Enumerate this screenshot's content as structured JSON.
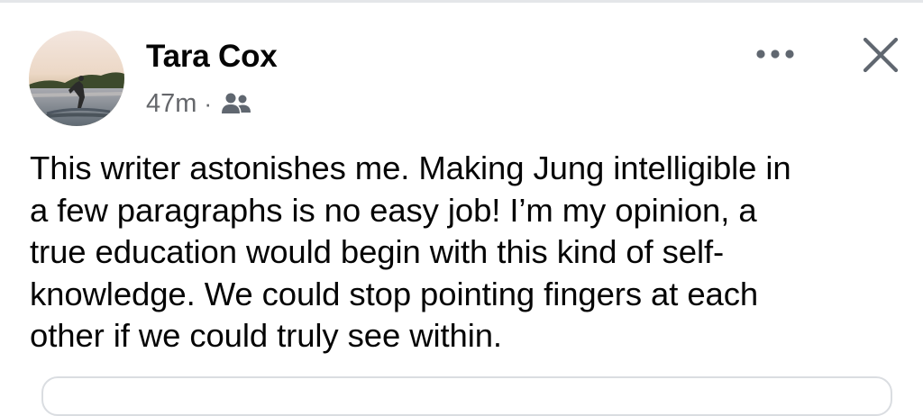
{
  "post": {
    "author": "Tara Cox",
    "time": "47m",
    "separator": "·",
    "audience_icon": "friends-icon",
    "more_icon": "more-horizontal-icon",
    "close_icon": "close-icon",
    "text_lines": [
      "This writer astonishes me. Making Jung intelligible in",
      "a few paragraphs is no easy job! I’m my opinion, a",
      "true education would begin with this kind of self-",
      "knowledge. We could stop pointing fingers at each",
      "other if we could truly see within."
    ]
  },
  "colors": {
    "text_primary": "#050505",
    "text_secondary": "#65676b",
    "icon": "#606770",
    "divider": "#e4e6e9"
  }
}
